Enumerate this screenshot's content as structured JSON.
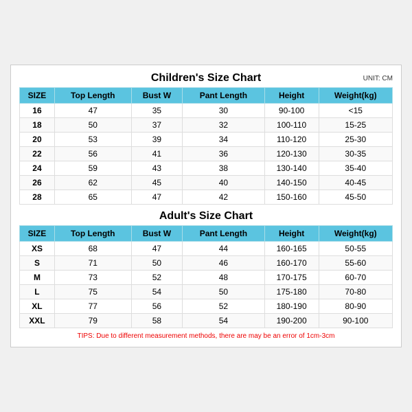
{
  "children_title": "Children's Size Chart",
  "adult_title": "Adult's Size Chart",
  "unit_label": "UNIT: CM",
  "headers": [
    "SIZE",
    "Top Length",
    "Bust W",
    "Pant Length",
    "Height",
    "Weight(kg)"
  ],
  "children_rows": [
    [
      "16",
      "47",
      "35",
      "30",
      "90-100",
      "<15"
    ],
    [
      "18",
      "50",
      "37",
      "32",
      "100-110",
      "15-25"
    ],
    [
      "20",
      "53",
      "39",
      "34",
      "110-120",
      "25-30"
    ],
    [
      "22",
      "56",
      "41",
      "36",
      "120-130",
      "30-35"
    ],
    [
      "24",
      "59",
      "43",
      "38",
      "130-140",
      "35-40"
    ],
    [
      "26",
      "62",
      "45",
      "40",
      "140-150",
      "40-45"
    ],
    [
      "28",
      "65",
      "47",
      "42",
      "150-160",
      "45-50"
    ]
  ],
  "adult_rows": [
    [
      "XS",
      "68",
      "47",
      "44",
      "160-165",
      "50-55"
    ],
    [
      "S",
      "71",
      "50",
      "46",
      "160-170",
      "55-60"
    ],
    [
      "M",
      "73",
      "52",
      "48",
      "170-175",
      "60-70"
    ],
    [
      "L",
      "75",
      "54",
      "50",
      "175-180",
      "70-80"
    ],
    [
      "XL",
      "77",
      "56",
      "52",
      "180-190",
      "80-90"
    ],
    [
      "XXL",
      "79",
      "58",
      "54",
      "190-200",
      "90-100"
    ]
  ],
  "tips": "TIPS: Due to different measurement methods, there are may be an error of 1cm-3cm"
}
